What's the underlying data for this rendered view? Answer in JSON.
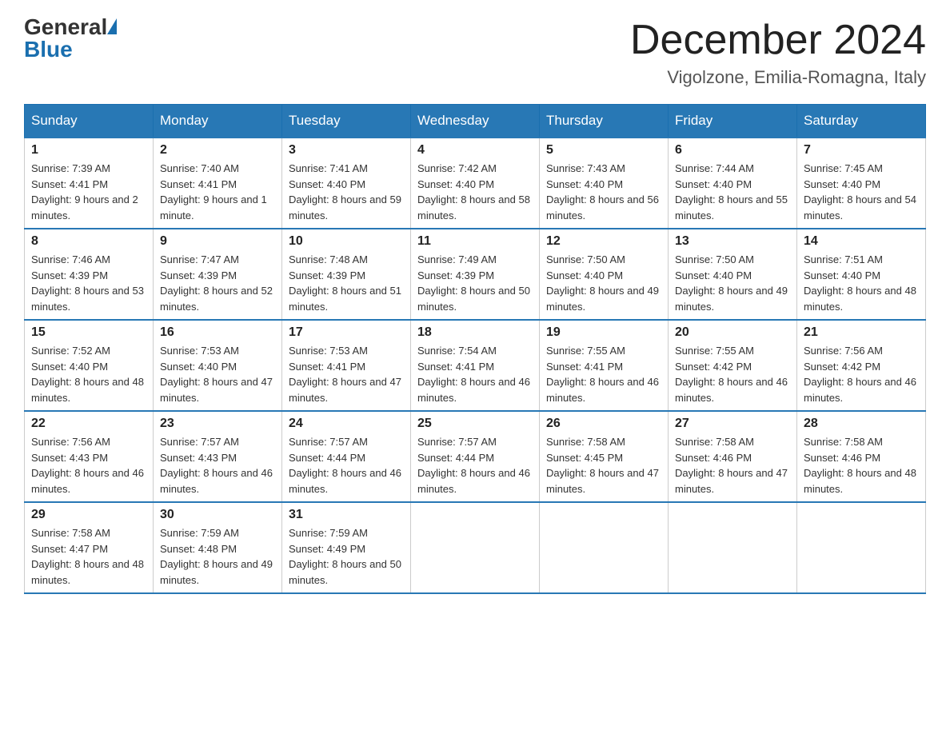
{
  "header": {
    "logo_general": "General",
    "logo_blue": "Blue",
    "month_title": "December 2024",
    "location": "Vigolzone, Emilia-Romagna, Italy"
  },
  "days_of_week": [
    "Sunday",
    "Monday",
    "Tuesday",
    "Wednesday",
    "Thursday",
    "Friday",
    "Saturday"
  ],
  "weeks": [
    [
      {
        "day": "1",
        "sunrise": "7:39 AM",
        "sunset": "4:41 PM",
        "daylight": "9 hours and 2 minutes."
      },
      {
        "day": "2",
        "sunrise": "7:40 AM",
        "sunset": "4:41 PM",
        "daylight": "9 hours and 1 minute."
      },
      {
        "day": "3",
        "sunrise": "7:41 AM",
        "sunset": "4:40 PM",
        "daylight": "8 hours and 59 minutes."
      },
      {
        "day": "4",
        "sunrise": "7:42 AM",
        "sunset": "4:40 PM",
        "daylight": "8 hours and 58 minutes."
      },
      {
        "day": "5",
        "sunrise": "7:43 AM",
        "sunset": "4:40 PM",
        "daylight": "8 hours and 56 minutes."
      },
      {
        "day": "6",
        "sunrise": "7:44 AM",
        "sunset": "4:40 PM",
        "daylight": "8 hours and 55 minutes."
      },
      {
        "day": "7",
        "sunrise": "7:45 AM",
        "sunset": "4:40 PM",
        "daylight": "8 hours and 54 minutes."
      }
    ],
    [
      {
        "day": "8",
        "sunrise": "7:46 AM",
        "sunset": "4:39 PM",
        "daylight": "8 hours and 53 minutes."
      },
      {
        "day": "9",
        "sunrise": "7:47 AM",
        "sunset": "4:39 PM",
        "daylight": "8 hours and 52 minutes."
      },
      {
        "day": "10",
        "sunrise": "7:48 AM",
        "sunset": "4:39 PM",
        "daylight": "8 hours and 51 minutes."
      },
      {
        "day": "11",
        "sunrise": "7:49 AM",
        "sunset": "4:39 PM",
        "daylight": "8 hours and 50 minutes."
      },
      {
        "day": "12",
        "sunrise": "7:50 AM",
        "sunset": "4:40 PM",
        "daylight": "8 hours and 49 minutes."
      },
      {
        "day": "13",
        "sunrise": "7:50 AM",
        "sunset": "4:40 PM",
        "daylight": "8 hours and 49 minutes."
      },
      {
        "day": "14",
        "sunrise": "7:51 AM",
        "sunset": "4:40 PM",
        "daylight": "8 hours and 48 minutes."
      }
    ],
    [
      {
        "day": "15",
        "sunrise": "7:52 AM",
        "sunset": "4:40 PM",
        "daylight": "8 hours and 48 minutes."
      },
      {
        "day": "16",
        "sunrise": "7:53 AM",
        "sunset": "4:40 PM",
        "daylight": "8 hours and 47 minutes."
      },
      {
        "day": "17",
        "sunrise": "7:53 AM",
        "sunset": "4:41 PM",
        "daylight": "8 hours and 47 minutes."
      },
      {
        "day": "18",
        "sunrise": "7:54 AM",
        "sunset": "4:41 PM",
        "daylight": "8 hours and 46 minutes."
      },
      {
        "day": "19",
        "sunrise": "7:55 AM",
        "sunset": "4:41 PM",
        "daylight": "8 hours and 46 minutes."
      },
      {
        "day": "20",
        "sunrise": "7:55 AM",
        "sunset": "4:42 PM",
        "daylight": "8 hours and 46 minutes."
      },
      {
        "day": "21",
        "sunrise": "7:56 AM",
        "sunset": "4:42 PM",
        "daylight": "8 hours and 46 minutes."
      }
    ],
    [
      {
        "day": "22",
        "sunrise": "7:56 AM",
        "sunset": "4:43 PM",
        "daylight": "8 hours and 46 minutes."
      },
      {
        "day": "23",
        "sunrise": "7:57 AM",
        "sunset": "4:43 PM",
        "daylight": "8 hours and 46 minutes."
      },
      {
        "day": "24",
        "sunrise": "7:57 AM",
        "sunset": "4:44 PM",
        "daylight": "8 hours and 46 minutes."
      },
      {
        "day": "25",
        "sunrise": "7:57 AM",
        "sunset": "4:44 PM",
        "daylight": "8 hours and 46 minutes."
      },
      {
        "day": "26",
        "sunrise": "7:58 AM",
        "sunset": "4:45 PM",
        "daylight": "8 hours and 47 minutes."
      },
      {
        "day": "27",
        "sunrise": "7:58 AM",
        "sunset": "4:46 PM",
        "daylight": "8 hours and 47 minutes."
      },
      {
        "day": "28",
        "sunrise": "7:58 AM",
        "sunset": "4:46 PM",
        "daylight": "8 hours and 48 minutes."
      }
    ],
    [
      {
        "day": "29",
        "sunrise": "7:58 AM",
        "sunset": "4:47 PM",
        "daylight": "8 hours and 48 minutes."
      },
      {
        "day": "30",
        "sunrise": "7:59 AM",
        "sunset": "4:48 PM",
        "daylight": "8 hours and 49 minutes."
      },
      {
        "day": "31",
        "sunrise": "7:59 AM",
        "sunset": "4:49 PM",
        "daylight": "8 hours and 50 minutes."
      },
      null,
      null,
      null,
      null
    ]
  ]
}
